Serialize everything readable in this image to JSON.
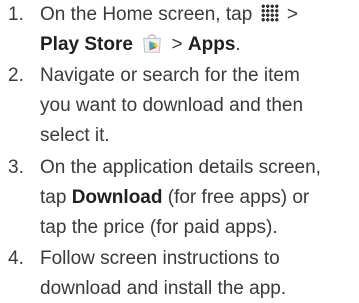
{
  "steps": [
    {
      "number": "1.",
      "line1": {
        "prefix": "On the Home screen, tap",
        "after_icon": ">"
      },
      "line2": {
        "play_store": "Play Store",
        "sep": ">",
        "apps": "Apps",
        "end": "."
      }
    },
    {
      "number": "2.",
      "lines": [
        "Navigate or search for the item",
        "you want to download and then",
        "select it."
      ]
    },
    {
      "number": "3.",
      "line1": "On the application details screen,",
      "line2": {
        "prefix": "tap ",
        "download": "Download",
        "suffix": " (for free apps) or"
      },
      "line3": "tap the price (for paid apps)."
    },
    {
      "number": "4.",
      "lines": [
        "Follow screen instructions to",
        "download and install the app."
      ]
    }
  ],
  "icons": {
    "apps_grid": "apps-grid-icon",
    "play_store": "play-store-icon"
  }
}
